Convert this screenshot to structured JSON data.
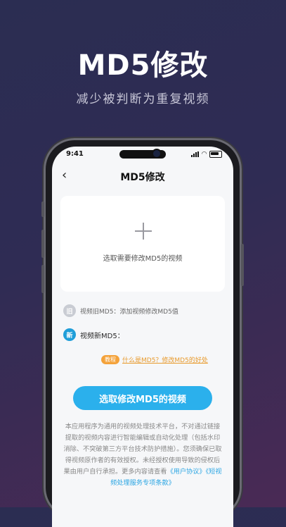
{
  "hero": {
    "title": "MD5修改",
    "subtitle": "减少被判断为重复视频"
  },
  "status_bar": {
    "time": "9:41"
  },
  "nav": {
    "back_icon": "chevron-left-icon",
    "back_glyph": "‹",
    "title": "MD5修改"
  },
  "upload": {
    "label": "选取需要修改MD5的视频"
  },
  "old_md5": {
    "badge": "旧",
    "label": "视频旧MD5：添加视频修改MD5值"
  },
  "new_md5": {
    "badge": "新",
    "label": "视频新MD5："
  },
  "tutorial": {
    "badge": "教程",
    "link": "什么是MD5？修改MD5的好处"
  },
  "primary_button": {
    "label": "选取修改MD5的视频"
  },
  "disclaimer": {
    "text": "本应用程序为通用的视频处理技术平台，不对通过链接提取的视频内容进行智能编辑或自动化处理（包括水印消除、不突破第三方平台技术防护措施）。您须确保已取得视频原作者的有效授权。未经授权使用导致的侵权后果由用户自行承担。更多内容请查看",
    "link_user": "《用户协议》",
    "link_terms": "《短视频处理服务专项条款》"
  },
  "colors": {
    "accent": "#2bb0ec",
    "new_badge": "#1f9ed9",
    "tutorial": "#f4a23a"
  }
}
